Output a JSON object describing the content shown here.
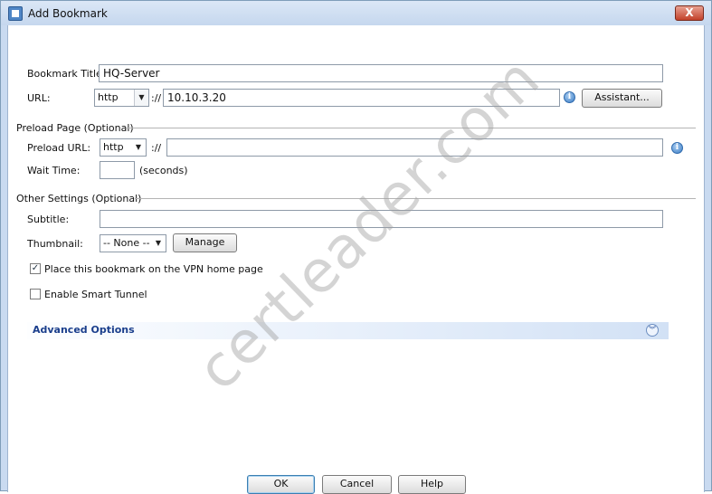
{
  "window": {
    "title": "Add Bookmark",
    "close_label": "X"
  },
  "bookmark": {
    "title_label": "Bookmark Title:",
    "title_value": "HQ-Server",
    "url_label": "URL:",
    "url_protocol": "http",
    "url_separator": "://",
    "url_value": "10.10.3.20",
    "assistant_label": "Assistant..."
  },
  "preload": {
    "section_label": "Preload Page (Optional)",
    "url_label": "Preload URL:",
    "url_protocol": "http",
    "url_separator": "://",
    "url_value": "",
    "wait_label": "Wait Time:",
    "wait_value": "",
    "wait_unit": "(seconds)"
  },
  "other": {
    "section_label": "Other Settings (Optional)",
    "subtitle_label": "Subtitle:",
    "subtitle_value": "",
    "thumbnail_label": "Thumbnail:",
    "thumbnail_value": "-- None --",
    "manage_label": "Manage",
    "vpn_home_label": "Place this bookmark on the VPN home page",
    "vpn_home_checked": true,
    "smart_tunnel_label": "Enable Smart Tunnel",
    "smart_tunnel_checked": false
  },
  "advanced": {
    "label": "Advanced Options"
  },
  "footer": {
    "ok_label": "OK",
    "cancel_label": "Cancel",
    "help_label": "Help"
  },
  "watermark": "certleader.com",
  "icons": {
    "info": "info-icon",
    "dropdown": "chevron-down-icon",
    "expand": "double-chevron-down-icon",
    "check": "check-icon"
  }
}
